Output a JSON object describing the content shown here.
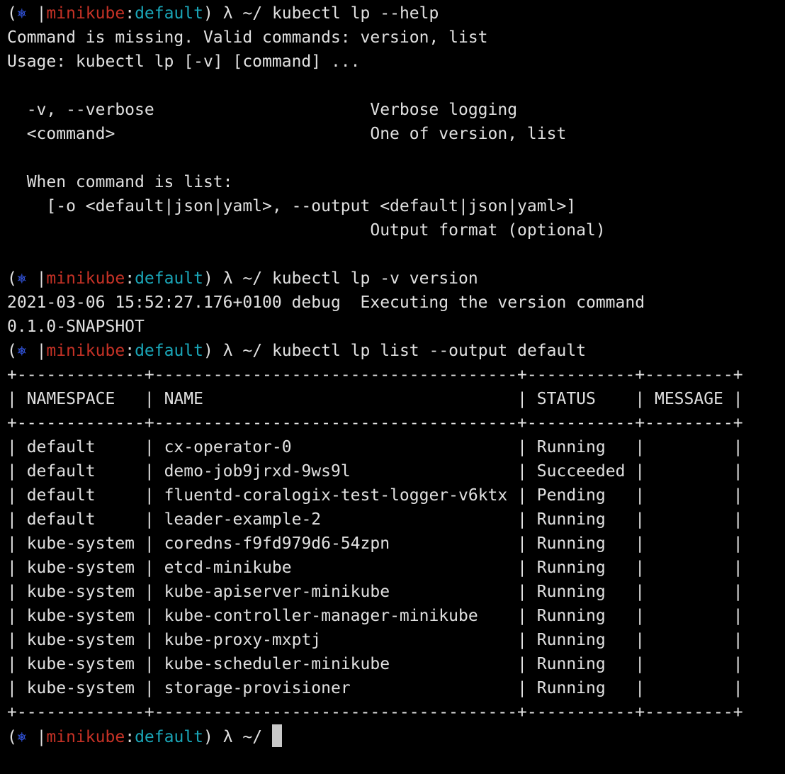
{
  "colors": {
    "background": "#000000",
    "foreground": "#e0e0e0",
    "prompt_star": "#2f4fd0",
    "prompt_context": "#c63226",
    "prompt_namespace": "#1aa6b8"
  },
  "prompt": {
    "open": "(",
    "star": "⎈",
    "separator": " |",
    "context": "minikube",
    "colon": ":",
    "namespace": "default",
    "tail": ") λ ~/ "
  },
  "commands": {
    "help": "kubectl lp --help",
    "version": "kubectl lp -v version",
    "list": "kubectl lp list --output default",
    "final": ""
  },
  "help_output": [
    "Command is missing. Valid commands: version, list",
    "Usage: kubectl lp [-v] [command] ...",
    "",
    "  -v, --verbose                      Verbose logging",
    "  <command>                          One of version, list",
    "",
    "  When command is list:",
    "    [-o <default|json|yaml>, --output <default|json|yaml>]",
    "                                     Output format (optional)",
    ""
  ],
  "version_output": [
    "2021-03-06 15:52:27.176+0100 debug  Executing the version command",
    "0.1.0-SNAPSHOT"
  ],
  "table": {
    "border": "+-------------+-------------------------------------+-----------+---------+",
    "columns": [
      "NAMESPACE",
      "NAME",
      "STATUS",
      "MESSAGE"
    ],
    "widths": [
      11,
      35,
      9,
      7
    ],
    "rows": [
      [
        "default",
        "cx-operator-0",
        "Running",
        ""
      ],
      [
        "default",
        "demo-job9jrxd-9ws9l",
        "Succeeded",
        ""
      ],
      [
        "default",
        "fluentd-coralogix-test-logger-v6ktx",
        "Pending",
        ""
      ],
      [
        "default",
        "leader-example-2",
        "Running",
        ""
      ],
      [
        "kube-system",
        "coredns-f9fd979d6-54zpn",
        "Running",
        ""
      ],
      [
        "kube-system",
        "etcd-minikube",
        "Running",
        ""
      ],
      [
        "kube-system",
        "kube-apiserver-minikube",
        "Running",
        ""
      ],
      [
        "kube-system",
        "kube-controller-manager-minikube",
        "Running",
        ""
      ],
      [
        "kube-system",
        "kube-proxy-mxptj",
        "Running",
        ""
      ],
      [
        "kube-system",
        "kube-scheduler-minikube",
        "Running",
        ""
      ],
      [
        "kube-system",
        "storage-provisioner",
        "Running",
        ""
      ]
    ]
  }
}
